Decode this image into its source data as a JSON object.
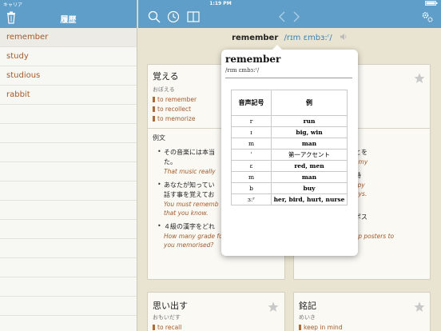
{
  "status_bar": {
    "carrier": "キャリア",
    "time": "1:19 PM"
  },
  "sidebar": {
    "title": "履歴",
    "items": [
      {
        "label": "remember"
      },
      {
        "label": "study"
      },
      {
        "label": "studious"
      },
      {
        "label": "rabbit"
      }
    ]
  },
  "word_bar": {
    "word": "remember",
    "ipa": "/rɪm ɛmbɜ:ʳ/"
  },
  "cards": [
    {
      "title": "覚える",
      "reading": "おぼえる",
      "meanings": [
        "to remember",
        "to recollect",
        "to memorize"
      ],
      "examples_label": "例文",
      "examples": [
        {
          "jp": "その音楽には本当",
          "jp2": "た。",
          "en": "That music really"
        },
        {
          "jp": "あなたが知ってい",
          "jp2": "話す事を覚えてお",
          "en": "You must rememb",
          "en2": "that you know."
        },
        {
          "jp": "４級の漢字をどれ",
          "en": "How many grade four kanji have",
          "en2": "you memorised?"
        }
      ]
    },
    {
      "examples": [
        {
          "jp": "て学生時代のことを",
          "en": "de my recollect my"
        },
        {
          "jp": "春を平穏無事な時",
          "en": "embers the happy",
          "en2": "s his halcyon days."
        },
        {
          "jp": "が有害なことを",
          "jp2": "知らせるためにポス",
          "jp3": "ターを掲げた。",
          "en": "The group put up posters to"
        }
      ]
    },
    {
      "title": "思い出す",
      "reading": "おもいだす",
      "meanings": [
        "to recall"
      ]
    },
    {
      "title": "銘記",
      "reading": "めいき",
      "meanings": [
        "keep in mind"
      ]
    }
  ],
  "popover": {
    "title": "remember",
    "ipa": "/rɪm ɛmbɜ:ʳ/",
    "table": {
      "headers": [
        "音声記号",
        "例"
      ],
      "rows": [
        {
          "symbol": "r",
          "example": "run"
        },
        {
          "symbol": "ɪ",
          "example": "big, win"
        },
        {
          "symbol": "m",
          "example": "man"
        },
        {
          "symbol": "ˈ",
          "example": "第一アクセント"
        },
        {
          "symbol": "ɛ",
          "example": "red, men"
        },
        {
          "symbol": "m",
          "example": "man"
        },
        {
          "symbol": "b",
          "example": "buy"
        },
        {
          "symbol": "ɜːʳ",
          "example": "her, bird, hurt, nurse"
        }
      ]
    }
  },
  "colors": {
    "header_blue": "#5e9ec9",
    "accent_brown": "#a25a2a",
    "background": "#e9e4d2"
  }
}
